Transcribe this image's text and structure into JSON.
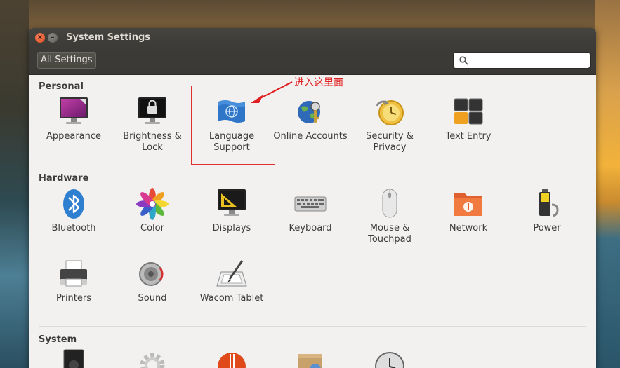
{
  "window": {
    "title": "System Settings"
  },
  "toolbar": {
    "all_settings_label": "All Settings",
    "search_placeholder": ""
  },
  "annotation": "进入这里面",
  "sections": {
    "personal": {
      "title": "Personal",
      "items": [
        {
          "label": "Appearance",
          "icon": "appearance-icon"
        },
        {
          "label": "Brightness & Lock",
          "icon": "brightness-lock-icon"
        },
        {
          "label": "Language Support",
          "icon": "language-support-icon"
        },
        {
          "label": "Online Accounts",
          "icon": "online-accounts-icon"
        },
        {
          "label": "Security & Privacy",
          "icon": "security-privacy-icon"
        },
        {
          "label": "Text Entry",
          "icon": "text-entry-icon"
        }
      ]
    },
    "hardware": {
      "title": "Hardware",
      "items": [
        {
          "label": "Bluetooth",
          "icon": "bluetooth-icon"
        },
        {
          "label": "Color",
          "icon": "color-icon"
        },
        {
          "label": "Displays",
          "icon": "displays-icon"
        },
        {
          "label": "Keyboard",
          "icon": "keyboard-icon"
        },
        {
          "label": "Mouse & Touchpad",
          "icon": "mouse-touchpad-icon"
        },
        {
          "label": "Network",
          "icon": "network-icon"
        },
        {
          "label": "Power",
          "icon": "power-icon"
        },
        {
          "label": "Printers",
          "icon": "printer-icon"
        },
        {
          "label": "Sound",
          "icon": "sound-icon"
        },
        {
          "label": "Wacom Tablet",
          "icon": "wacom-tablet-icon"
        }
      ]
    },
    "system": {
      "title": "System"
    }
  }
}
